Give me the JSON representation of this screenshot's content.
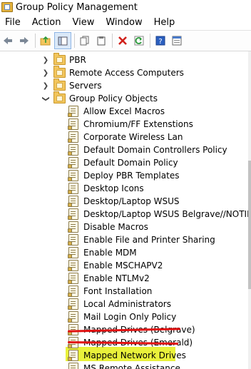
{
  "window": {
    "title": "Group Policy Management"
  },
  "menu": [
    {
      "label": "File"
    },
    {
      "label": "Action"
    },
    {
      "label": "View"
    },
    {
      "label": "Window"
    },
    {
      "label": "Help"
    }
  ],
  "toolbar": {
    "buttons": [
      "back-arrow-icon",
      "forward-arrow-icon",
      "up-folder-icon",
      "show-hide-tree-icon",
      "copy-icon",
      "paste-icon",
      "delete-icon",
      "refresh-icon",
      "help-icon",
      "properties-icon"
    ]
  },
  "tree": {
    "folders": [
      {
        "label": "PBR",
        "expanded": false
      },
      {
        "label": "Remote Access Computers",
        "expanded": false
      },
      {
        "label": "Servers",
        "expanded": false
      },
      {
        "label": "Group Policy Objects",
        "expanded": true
      }
    ],
    "gpos": [
      {
        "label": "Allow Excel Macros"
      },
      {
        "label": "Chromium/FF Extenstions"
      },
      {
        "label": "Corporate Wireless Lan"
      },
      {
        "label": "Default Domain Controllers Policy"
      },
      {
        "label": "Default Domain Policy"
      },
      {
        "label": "Deploy PBR Templates"
      },
      {
        "label": "Desktop Icons"
      },
      {
        "label": "Desktop/Laptop WSUS"
      },
      {
        "label": "Desktop/Laptop WSUS Belgrave//NOTINUSE"
      },
      {
        "label": "Disable Macros"
      },
      {
        "label": "Enable File and Printer Sharing"
      },
      {
        "label": "Enable MDM"
      },
      {
        "label": "Enable MSCHAPV2"
      },
      {
        "label": "Enable NTLMv2"
      },
      {
        "label": "Font Installation"
      },
      {
        "label": "Local Administrators"
      },
      {
        "label": "Mail Login Only Policy"
      },
      {
        "label": "Mapped Drives (Belgrave)",
        "struck": true
      },
      {
        "label": "Mapped Drives (Emerald)",
        "struck": true
      },
      {
        "label": "Mapped Network Drives",
        "highlighted": true
      },
      {
        "label": "MS Remote Assistance"
      }
    ]
  },
  "colors": {
    "strike": "#e01010",
    "highlight": "#e9f13b"
  }
}
